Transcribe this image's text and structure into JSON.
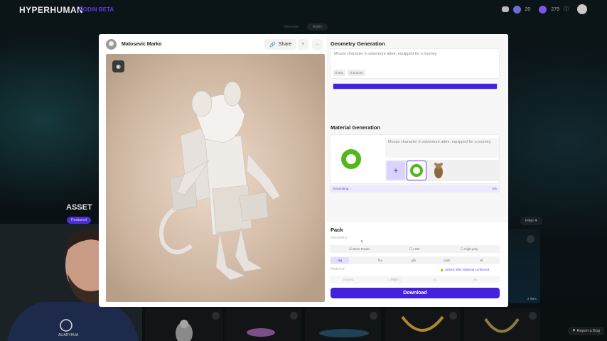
{
  "app": {
    "logo": "HYPERHUMAN",
    "logo_sub": "RODIN BETA",
    "user_level": "20",
    "credits": "279"
  },
  "top_tabs": [
    "Overview",
    "Rodin"
  ],
  "background": {
    "section_title": "ASSET",
    "featured_label": "Featured",
    "filter_label": "Filter",
    "side_views": "2 likes",
    "report_label": "Report a Bug",
    "webcam_shirt_text": "ALIARYHUA"
  },
  "modal": {
    "author_name": "Matosevic Marko",
    "share_label": "Share",
    "geometry": {
      "title": "Geometry Generation",
      "prompt": "Mouse character in adventure attire, equipped for a journey.",
      "tags": [
        "chatty",
        "character"
      ]
    },
    "material": {
      "title": "Material Generation",
      "prompt": "Mouse character in adventure attire, equipped for a journey.",
      "progress_label": "Generating...",
      "progress_pct": "0%",
      "progress_value": 0.0
    },
    "pack": {
      "title": "Pack",
      "geometry_label": "Geometry",
      "model_options": [
        "Base Model",
        "LOD",
        "High-poly"
      ],
      "format_options": [
        "obj",
        "fbx",
        "glb",
        "usdz",
        "stl"
      ],
      "selected_format": "obj",
      "material_label": "Material",
      "unlock_text": "Unlock after Material confirmed",
      "material_options": [
        "Shaded",
        "PBR",
        "1K",
        "4K"
      ],
      "download_label": "Download"
    }
  },
  "colors": {
    "accent": "#4422dd",
    "ring_green": "#52b81a",
    "viewer_bg": "#e4cdb8"
  }
}
